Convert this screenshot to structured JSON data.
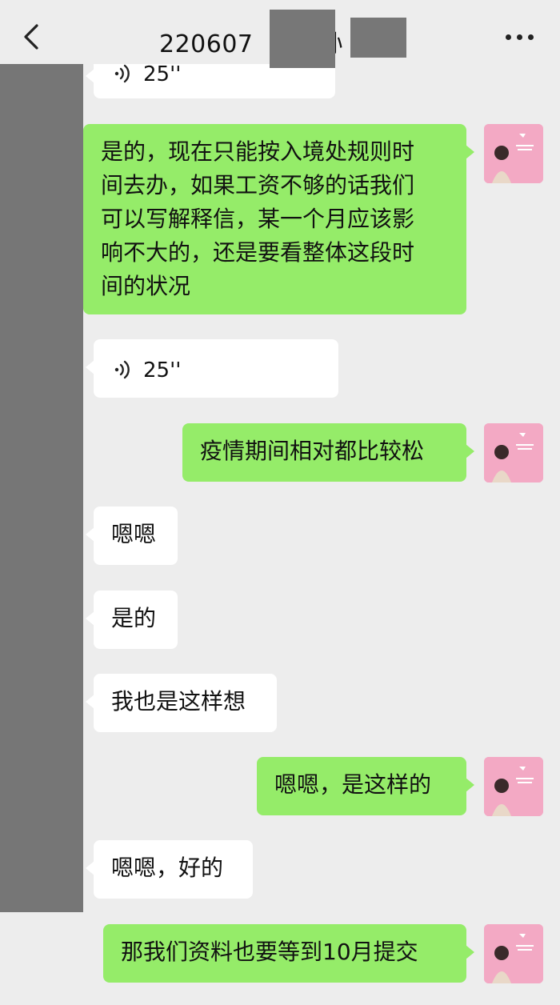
{
  "header": {
    "title_visible": "220607",
    "title_tail": "孙"
  },
  "messages": [
    {
      "side": "in",
      "type": "voice",
      "duration": "25''",
      "partial": true
    },
    {
      "side": "out",
      "type": "text",
      "text": "是的，现在只能按入境处规则时\n间去办，如果工资不够的话我们\n可以写解释信，某一个月应该影\n响不大的，还是要看整体这段时\n间的状况"
    },
    {
      "side": "in",
      "type": "voice",
      "duration": "25''"
    },
    {
      "side": "out",
      "type": "text",
      "text": "疫情期间相对都比较松"
    },
    {
      "side": "in",
      "type": "text",
      "text": "嗯嗯"
    },
    {
      "side": "in",
      "type": "text",
      "text": "是的"
    },
    {
      "side": "in",
      "type": "text",
      "text": "我也是这样想"
    },
    {
      "side": "out",
      "type": "text",
      "text": "嗯嗯，是这样的"
    },
    {
      "side": "in",
      "type": "text",
      "text": "嗯嗯，好的"
    },
    {
      "side": "out",
      "type": "text",
      "text": "那我们资料也要等到10月提交"
    }
  ],
  "colors": {
    "background": "#ededed",
    "incoming_bubble": "#ffffff",
    "outgoing_bubble": "#95ec69",
    "avatar": "#f3a9c4"
  }
}
